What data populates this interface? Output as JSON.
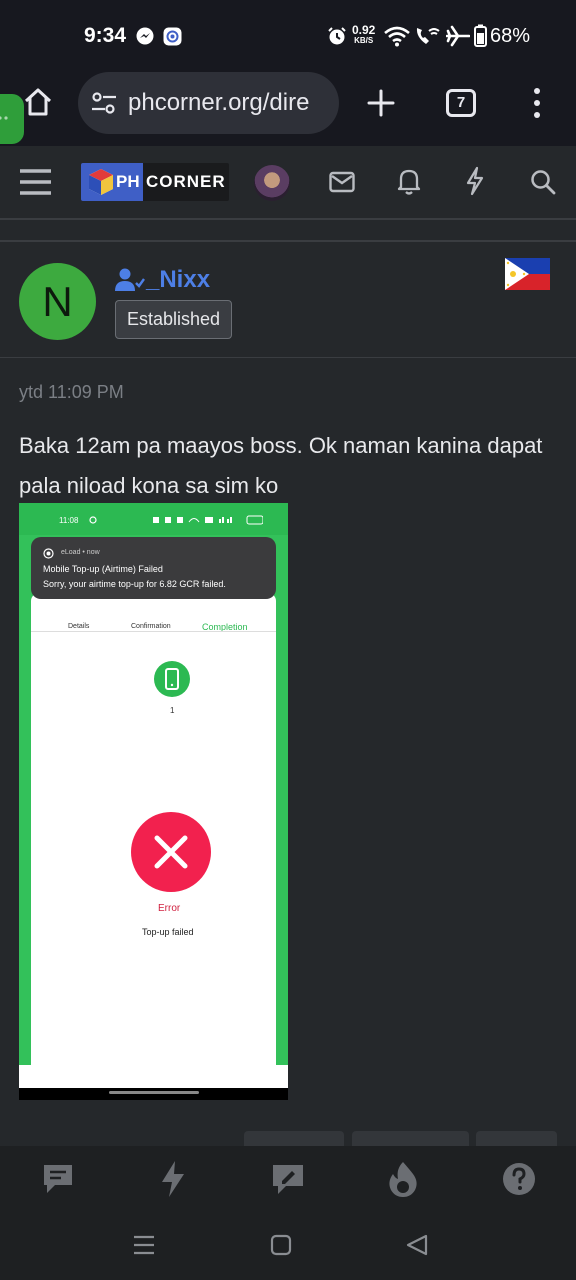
{
  "status_bar": {
    "time": "9:34",
    "net_speed_value": "0.92",
    "net_speed_unit": "KB/S",
    "battery": "68%"
  },
  "browser": {
    "url": "phcorner.org/dire",
    "tab_count": "7"
  },
  "site": {
    "logo_ph": "PH",
    "logo_corner": "CORNER"
  },
  "post": {
    "author_initial": "N",
    "author_name": "_Nixx",
    "author_badge": "Established",
    "timestamp": "ytd 11:09 PM",
    "body": "Baka 12am pa maayos boss. Ok naman kanina dapat pala niload kona sa sim ko"
  },
  "attachment": {
    "status_time": "11:08",
    "notif_app": "eLoad • now",
    "notif_title": "Mobile Top-up (Airtime) Failed",
    "notif_text": "Sorry, your airtime top-up for 6.82 GCR failed.",
    "step_details": "Details",
    "step_confirmation": "Confirmation",
    "step_completion": "Completion",
    "phone_number": "1",
    "error_label": "Error",
    "error_text": "Top-up failed"
  },
  "colors": {
    "accent_blue": "#4d7fe6",
    "avatar_green": "#3daa3f",
    "error_red": "#f2214e",
    "success_green": "#33c15a"
  }
}
